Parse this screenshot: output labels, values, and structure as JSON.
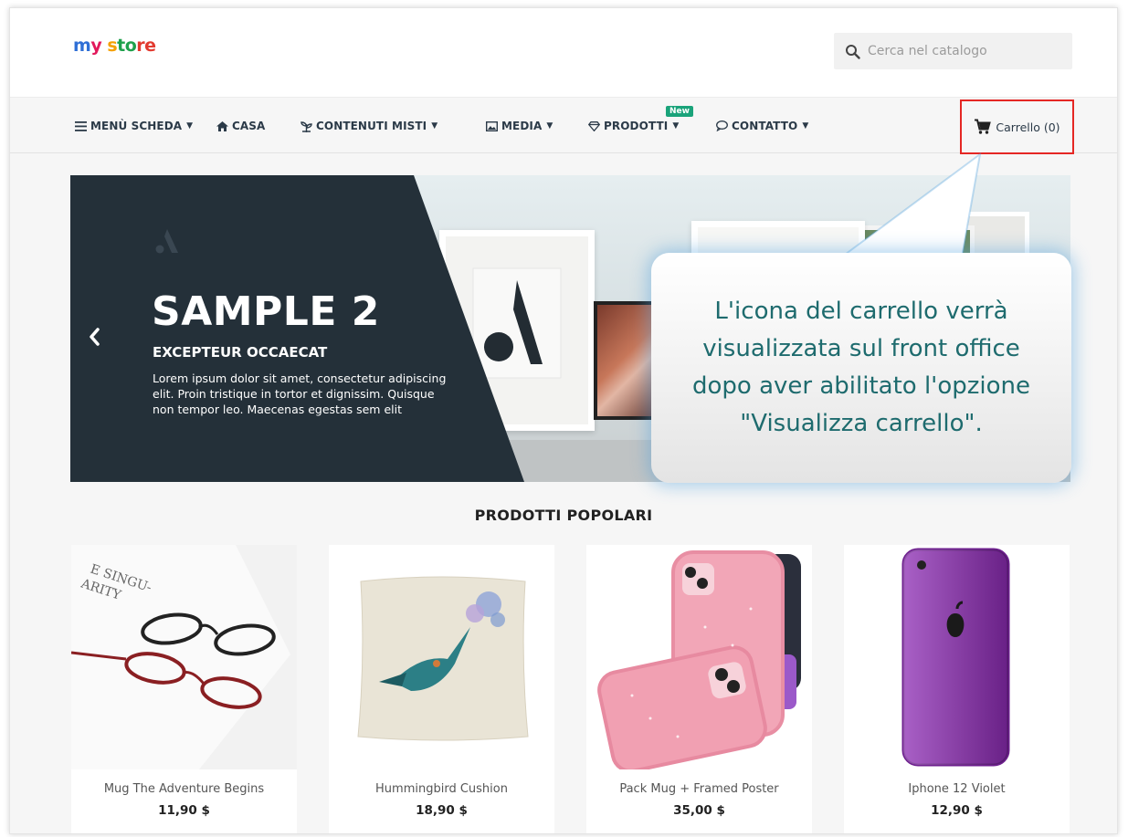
{
  "header": {
    "logo": {
      "part1": "m",
      "part2": "y",
      "part3": " s",
      "part4": "to",
      "part5": "re"
    },
    "search": {
      "placeholder": "Cerca nel catalogo"
    }
  },
  "nav": {
    "items": [
      {
        "label": "MENÙ SCHEDA",
        "icon": "hamburger-icon",
        "has_caret": true
      },
      {
        "label": "CASA",
        "icon": "home-icon",
        "has_caret": false
      },
      {
        "label": "CONTENUTI MISTI",
        "icon": "plant-icon",
        "has_caret": true
      },
      {
        "label": "MEDIA",
        "icon": "image-icon",
        "has_caret": true
      },
      {
        "label": "PRODOTTI",
        "icon": "diamond-icon",
        "has_caret": true,
        "badge": "New"
      },
      {
        "label": "CONTATTO",
        "icon": "chat-icon",
        "has_caret": true
      }
    ],
    "cart": {
      "label": "Carrello (0)",
      "icon": "cart-icon",
      "highlight_color": "#e52724"
    }
  },
  "banner": {
    "title": "SAMPLE 2",
    "subtitle": "EXCEPTEUR OCCAECAT",
    "text": "Lorem ipsum dolor sit amet, consectetur adipiscing elit. Proin tristique in tortor et dignissim. Quisque non tempor leo. Maecenas egestas sem elit",
    "prev_icon": "chevron-left-icon"
  },
  "callout": {
    "text": "L'icona del carrello verrà visualizzata sul front office dopo aver abilitato l'opzione \"Visualizza carrello\"."
  },
  "products": {
    "title": "PRODOTTI POPOLARI",
    "items": [
      {
        "name": "Mug The Adventure Begins",
        "price": "11,90 $"
      },
      {
        "name": "Hummingbird Cushion",
        "price": "18,90 $"
      },
      {
        "name": "Pack Mug + Framed Poster",
        "price": "35,00 $"
      },
      {
        "name": "Iphone 12 Violet",
        "price": "12,90 $"
      }
    ]
  },
  "colors": {
    "accent": "#1aa37a",
    "dark": "#243039",
    "callout_text": "#1e6b6e"
  }
}
